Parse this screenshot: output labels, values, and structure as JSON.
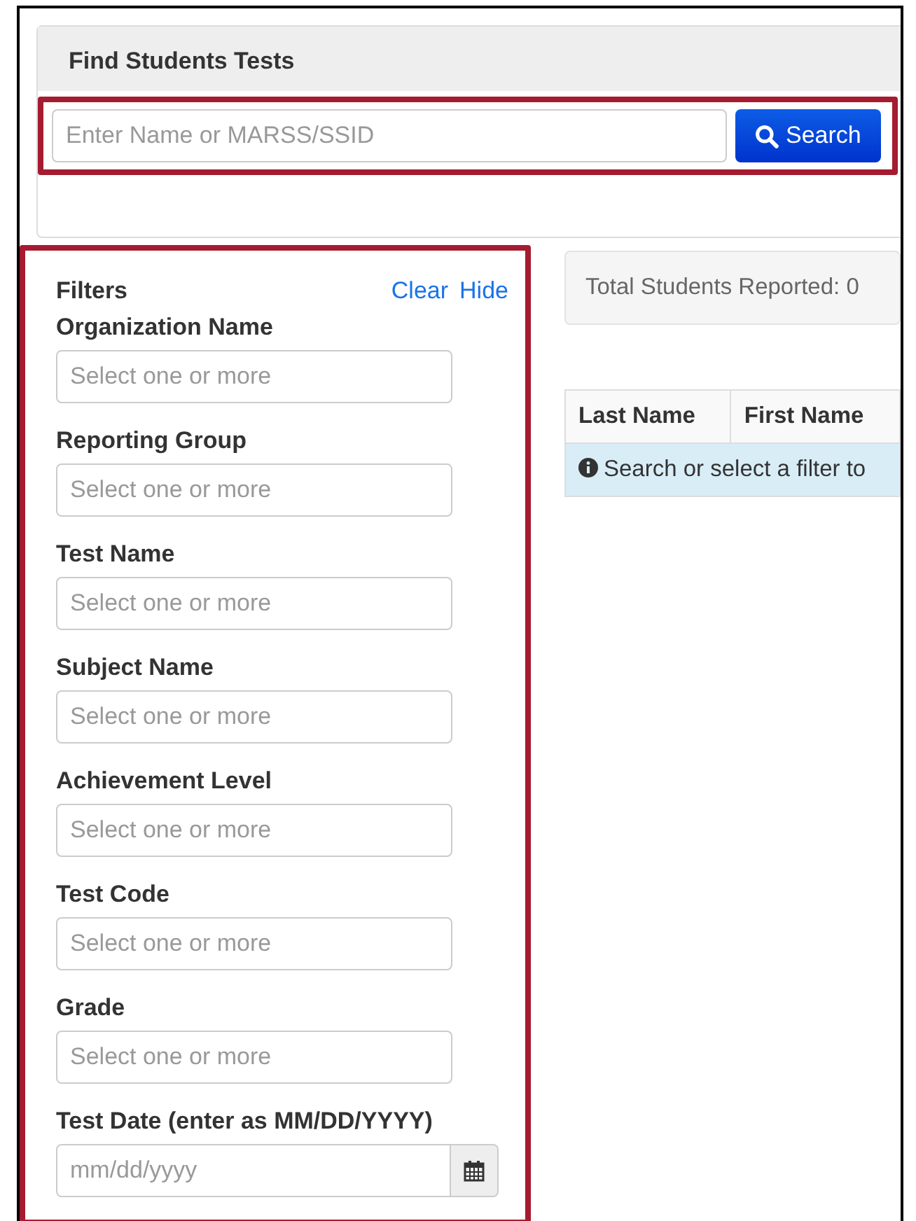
{
  "panel": {
    "title": "Find Students Tests",
    "search": {
      "placeholder": "Enter Name or MARSS/SSID",
      "button": "Search"
    }
  },
  "filters": {
    "title": "Filters",
    "actions": [
      "Clear",
      "Hide"
    ],
    "fields": [
      {
        "label": "Organization Name",
        "kind": "select",
        "placeholder": "Select one or more"
      },
      {
        "label": "Reporting Group",
        "kind": "select",
        "placeholder": "Select one or more"
      },
      {
        "label": "Test Name",
        "kind": "select",
        "placeholder": "Select one or more"
      },
      {
        "label": "Subject Name",
        "kind": "select",
        "placeholder": "Select one or more"
      },
      {
        "label": "Achievement Level",
        "kind": "select",
        "placeholder": "Select one or more"
      },
      {
        "label": "Test Code",
        "kind": "select",
        "placeholder": "Select one or more"
      },
      {
        "label": "Grade",
        "kind": "select",
        "placeholder": "Select one or more"
      },
      {
        "label": "Test Date (enter as MM/DD/YYYY)",
        "kind": "date",
        "placeholder": "mm/dd/yyyy"
      }
    ]
  },
  "summary": "Total Students Reported: 0",
  "table": {
    "columns": [
      "Last Name",
      "First Name"
    ],
    "message": "Search or select a filter to"
  }
}
